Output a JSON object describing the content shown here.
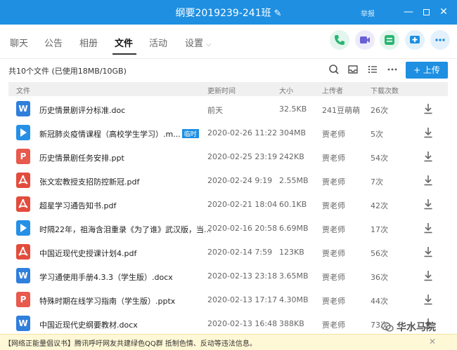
{
  "window": {
    "title": "纲要2019239-241班",
    "edit_icon": "✎",
    "report": "举报",
    "min": "—",
    "close": "✕"
  },
  "tabs": [
    {
      "label": "聊天"
    },
    {
      "label": "公告"
    },
    {
      "label": "相册"
    },
    {
      "label": "文件"
    },
    {
      "label": "活动"
    },
    {
      "label": "设置"
    }
  ],
  "tab_icons": [
    "phone-icon",
    "video-icon",
    "classroom-icon",
    "share-screen-icon",
    "more-icon"
  ],
  "filebar": {
    "summary": "共10个文件 (已使用18MB/10GB)",
    "upload_label": "+ 上传"
  },
  "table": {
    "headers": {
      "name": "文件",
      "time": "更新时间",
      "size": "大小",
      "uploader": "上传者",
      "downloads": "下载次数"
    },
    "rows": [
      {
        "type": "doc",
        "name": "历史情景剧评分标准.doc",
        "time": "前天",
        "size": "32.5KB",
        "uploader": "241豆萌萌",
        "downloads": "26次"
      },
      {
        "type": "video",
        "name": "新冠肺炎疫情课程（高校学生学习）.m...",
        "tag": "临时",
        "time": "2020-02-26 11:22",
        "size": "304MB",
        "uploader": "贾老师",
        "downloads": "5次"
      },
      {
        "type": "ppt",
        "name": "历史情景剧任务安排.ppt",
        "time": "2020-02-25 23:19",
        "size": "242KB",
        "uploader": "贾老师",
        "downloads": "54次"
      },
      {
        "type": "pdf",
        "name": "张文宏教授支招防控新冠.pdf",
        "time": "2020-02-24 9:19",
        "size": "2.55MB",
        "uploader": "贾老师",
        "downloads": "7次"
      },
      {
        "type": "pdf",
        "name": "超星学习通告知书.pdf",
        "time": "2020-02-21 18:04",
        "size": "60.1KB",
        "uploader": "贾老师",
        "downloads": "42次"
      },
      {
        "type": "video",
        "name": "时隔22年，祖海含泪重录《为了谁》武汉版，当...",
        "time": "2020-02-16 20:58",
        "size": "6.69MB",
        "uploader": "贾老师",
        "downloads": "17次"
      },
      {
        "type": "pdf",
        "name": "中国近现代史授课计划4.pdf",
        "time": "2020-02-14 7:59",
        "size": "123KB",
        "uploader": "贾老师",
        "downloads": "56次"
      },
      {
        "type": "doc",
        "name": "学习通使用手册4.3.3（学生版）.docx",
        "time": "2020-02-13 23:18",
        "size": "3.65MB",
        "uploader": "贾老师",
        "downloads": "36次"
      },
      {
        "type": "ppt",
        "name": "特殊时期在线学习指南（学生版）.pptx",
        "time": "2020-02-13 17:17",
        "size": "4.30MB",
        "uploader": "贾老师",
        "downloads": "44次"
      },
      {
        "type": "doc",
        "name": "中国近现代史纲要教材.docx",
        "time": "2020-02-13 16:48",
        "size": "388KB",
        "uploader": "贾老师",
        "downloads": "73次"
      }
    ]
  },
  "icon_letters": {
    "doc": "W",
    "ppt": "P"
  },
  "notice": {
    "text": "【网络正能量倡议书】腾讯呼吁网友共建绿色QQ群 抵制色情、反动等违法信息。",
    "close": "✕"
  },
  "watermark": "华水马院",
  "colors": {
    "accent": "#1e8fe1",
    "doc": "#2f7fdc",
    "video": "#2590e6",
    "ppt": "#e8594e",
    "pdf": "#e34c3c",
    "notice_bg": "#fff8d6"
  }
}
